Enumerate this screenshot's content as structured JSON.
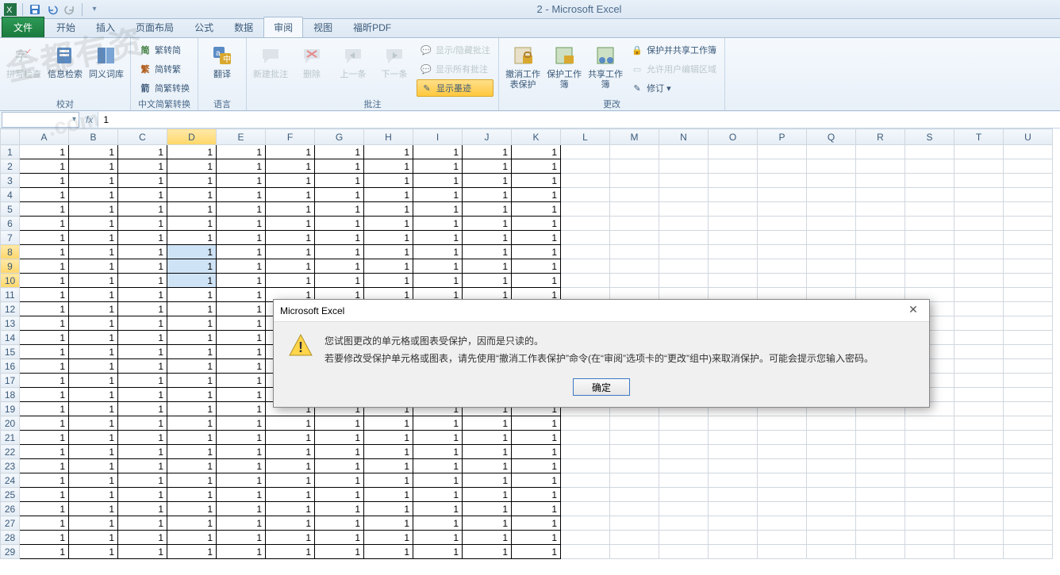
{
  "title": "2 - Microsoft Excel",
  "qat": {
    "dropdown": "▾"
  },
  "tabs": {
    "file": "文件",
    "items": [
      "开始",
      "插入",
      "页面布局",
      "公式",
      "数据",
      "审阅",
      "视图",
      "福昕PDF"
    ],
    "active_index": 5
  },
  "ribbon": {
    "groups": [
      {
        "label": "校对",
        "big": [
          {
            "name": "spelling",
            "label": "拼写检查",
            "disabled": true
          },
          {
            "name": "research",
            "label": "信息检索",
            "disabled": false
          },
          {
            "name": "thesaurus",
            "label": "同义词库",
            "disabled": false
          }
        ]
      },
      {
        "label": "中文简繁转换",
        "small": [
          {
            "name": "simp",
            "label": "繁转简",
            "prefix": "简"
          },
          {
            "name": "trad",
            "label": "简转繁",
            "prefix": "繁"
          },
          {
            "name": "conv",
            "label": "简繁转换",
            "prefix": "箭"
          }
        ]
      },
      {
        "label": "语言",
        "big": [
          {
            "name": "translate",
            "label": "翻译",
            "disabled": false
          }
        ]
      },
      {
        "label": "批注",
        "big": [
          {
            "name": "new-comment",
            "label": "新建批注",
            "disabled": true
          },
          {
            "name": "delete-comment",
            "label": "删除",
            "disabled": true
          },
          {
            "name": "prev-comment",
            "label": "上一条",
            "disabled": true
          },
          {
            "name": "next-comment",
            "label": "下一条",
            "disabled": true
          }
        ],
        "small": [
          {
            "name": "show-hide",
            "label": "显示/隐藏批注",
            "disabled": true
          },
          {
            "name": "show-all",
            "label": "显示所有批注",
            "disabled": true
          },
          {
            "name": "show-ink",
            "label": "显示墨迹",
            "hl": true
          }
        ]
      },
      {
        "label": "更改",
        "big": [
          {
            "name": "unprotect-sheet",
            "label": "撤消工作表保护"
          },
          {
            "name": "protect-wb",
            "label": "保护工作簿"
          },
          {
            "name": "share-wb",
            "label": "共享工作簿"
          }
        ],
        "small": [
          {
            "name": "protect-share",
            "label": "保护并共享工作簿"
          },
          {
            "name": "allow-edit",
            "label": "允许用户编辑区域",
            "disabled": true
          },
          {
            "name": "track",
            "label": "修订 ▾"
          }
        ]
      }
    ]
  },
  "formula_bar": {
    "value": "1"
  },
  "columns": [
    "A",
    "B",
    "C",
    "D",
    "E",
    "F",
    "G",
    "H",
    "I",
    "J",
    "K",
    "L",
    "M",
    "N",
    "O",
    "P",
    "Q",
    "R",
    "S",
    "T",
    "U"
  ],
  "filled_cols": 11,
  "rows": 29,
  "cell_value": "1",
  "selected_col_index": 3,
  "selected_rows": [
    7,
    8,
    9
  ],
  "highlight_row_headers": [
    7,
    8,
    9
  ],
  "dialog": {
    "title": "Microsoft Excel",
    "line1": "您试图更改的单元格或图表受保护，因而是只读的。",
    "line2": "若要修改受保护单元格或图表，请先使用“撤消工作表保护”命令(在“审阅”选项卡的“更改”组中)来取消保护。可能会提示您输入密码。",
    "ok": "确定"
  },
  "watermark": "全都有资",
  "watermark2": ".com"
}
